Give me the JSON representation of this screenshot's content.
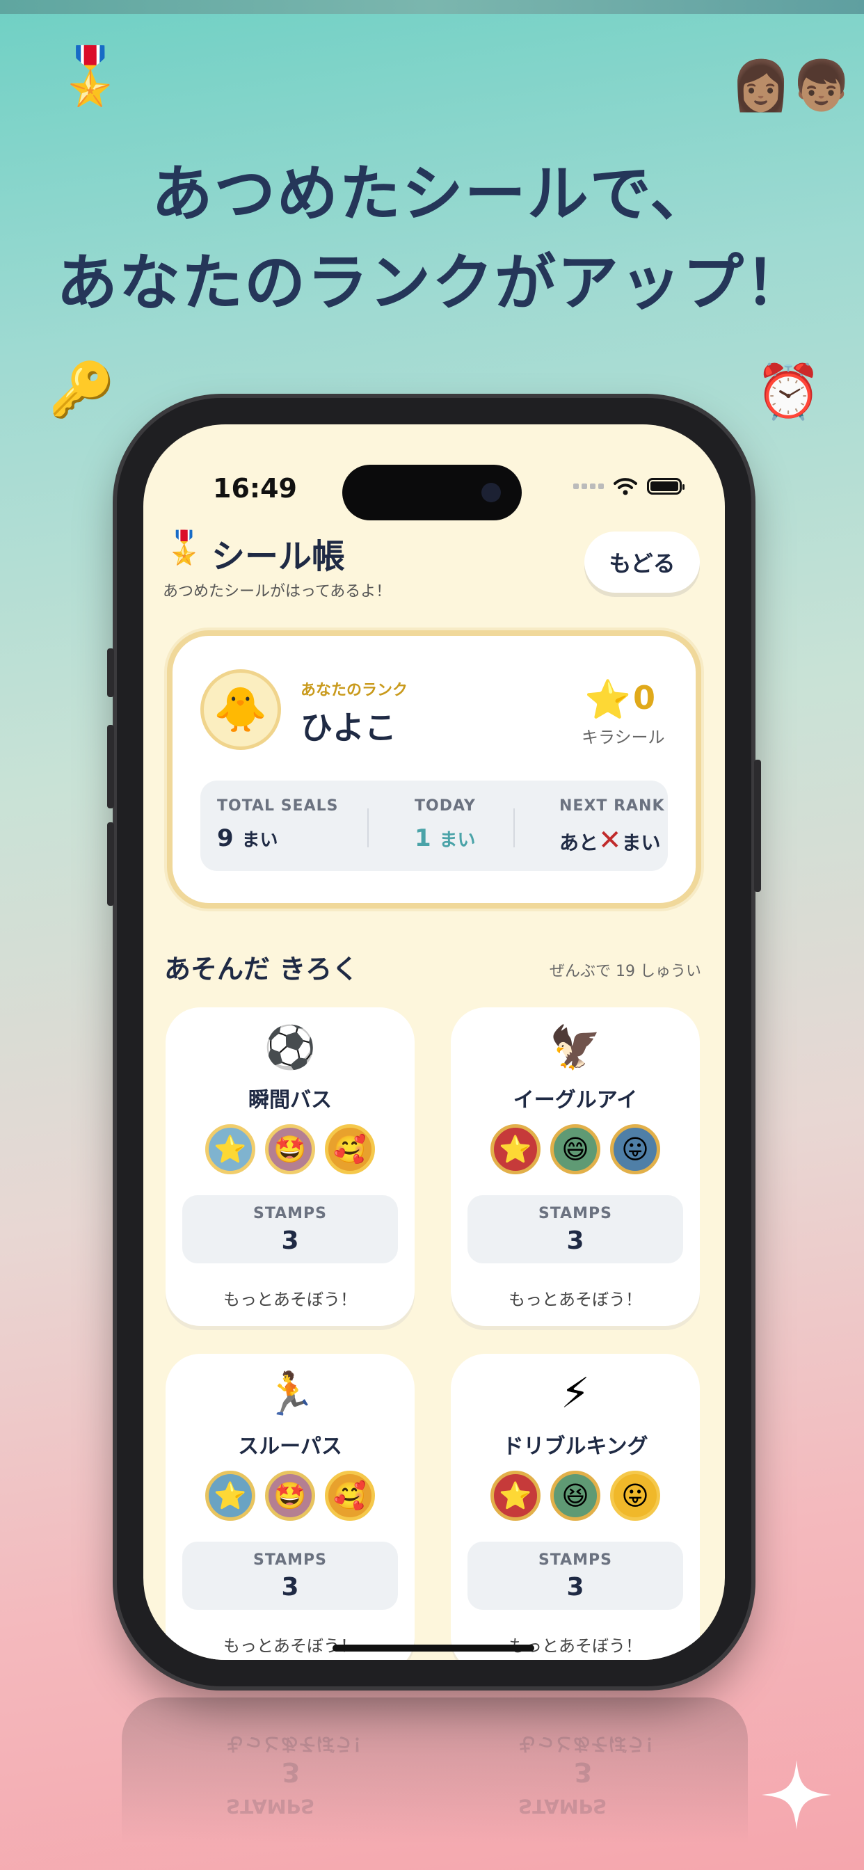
{
  "headline": {
    "line1": "あつめたシールで、",
    "line2": "あなたのランクがアップ！"
  },
  "decorations": {
    "top_left": "🎖️",
    "top_right": "👩🏽‍👦🏽",
    "mid_left": "🔑",
    "mid_right": "⏰"
  },
  "status_bar": {
    "time": "16:49"
  },
  "header": {
    "icon": "🎖️",
    "title": "シール帳",
    "subtitle": "あつめたシールがはってあるよ！",
    "back_label": "もどる"
  },
  "rank": {
    "avatar": "🐥",
    "label": "あなたのランク",
    "name": "ひよこ",
    "kira_icon": "⭐",
    "kira_count": "0",
    "kira_label": "キラシール",
    "stats": {
      "total_label": "TOTAL SEALS",
      "total_value": "9",
      "total_unit": "まい",
      "today_label": "TODAY",
      "today_value": "1",
      "today_unit": "まい",
      "next_label": "NEXT RANK",
      "next_prefix": "あと",
      "next_mark": "✕",
      "next_unit": "まい"
    }
  },
  "section": {
    "title": "あそんだ きろく",
    "count_text": "ぜんぶで 19 しゅうい"
  },
  "stamps_label": "STAMPS",
  "games": [
    {
      "icon": "⚽",
      "name": "瞬間バス",
      "seals": [
        "⭐",
        "🤩",
        "🥰"
      ],
      "stamps": "3",
      "footer": "もっとあそぼう！"
    },
    {
      "icon": "🦅",
      "name": "イーグルアイ",
      "seals": [
        "⭐",
        "😄",
        "😛"
      ],
      "stamps": "3",
      "footer": "もっとあそぼう！"
    },
    {
      "icon": "🏃",
      "name": "スルーパス",
      "seals": [
        "⭐",
        "🤩",
        "🥰"
      ],
      "stamps": "3",
      "footer": "もっとあそぼう！"
    },
    {
      "icon": "⚡",
      "name": "ドリブルキング",
      "seals": [
        "⭐",
        "😆",
        "😛"
      ],
      "stamps": "3",
      "footer": "もっとあそぼう！"
    }
  ],
  "colors": {
    "headline": "#253659",
    "accent_gold": "#e0a91a",
    "today_teal": "#4aa3a8",
    "screen_bg": "#fdf6dc"
  }
}
